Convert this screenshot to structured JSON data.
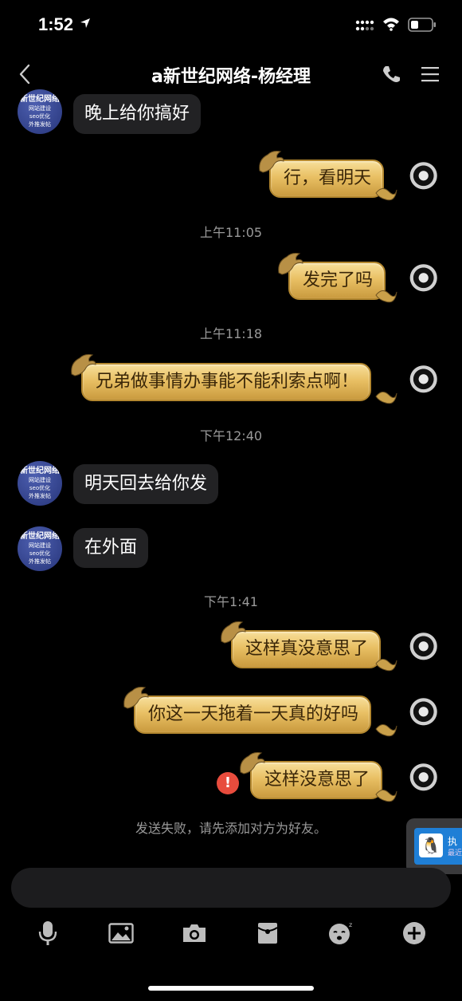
{
  "status": {
    "time": "1:52"
  },
  "nav": {
    "title": "a新世纪网络-杨经理"
  },
  "contact_avatar": {
    "line1": "新世纪网络",
    "line2": "网站建设",
    "line3": "seo优化",
    "line4": "外推发帖"
  },
  "messages": {
    "m1": "晚上给你搞好",
    "m2": "行，看明天",
    "t1": "上午11:05",
    "m3": "发完了吗",
    "t2": "上午11:18",
    "m4": "兄弟做事情办事能不能利索点啊！",
    "t3": "下午12:40",
    "m5": "明天回去给你发",
    "m6": "在外面",
    "t4": "下午1:41",
    "m7": "这样真没意思了",
    "m8": "你这一天拖着一天真的好吗",
    "m9": "这样没意思了"
  },
  "failure": {
    "icon": "!",
    "text": "发送失败，请先添加对方为好友。"
  },
  "floating_widget": {
    "title": "执",
    "subtitle": "最近"
  },
  "toolbar": [
    "mic-icon",
    "image-icon",
    "camera-icon",
    "red-packet-icon",
    "emoji-icon",
    "plus-icon"
  ],
  "colors": {
    "gold_bubble": "#e9c064",
    "left_bubble": "#222224",
    "fail_red": "#e84c3d"
  }
}
